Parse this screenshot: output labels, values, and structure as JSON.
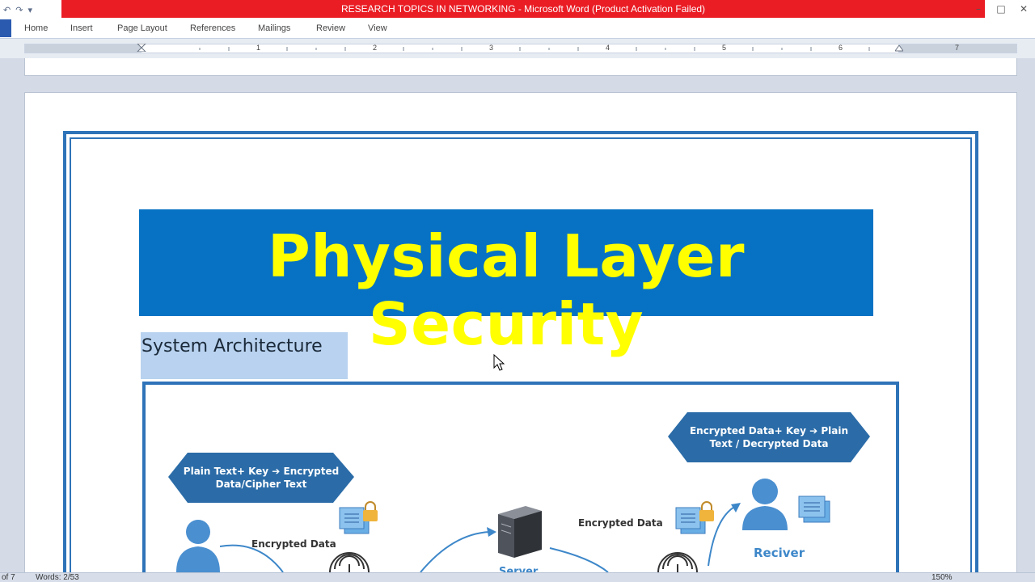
{
  "window": {
    "title": "RESEARCH TOPICS IN NETWORKING  -  Microsoft Word (Product Activation Failed)",
    "title_bar_color": "#ea1c24",
    "controls": [
      "minimize-icon",
      "maximize-icon",
      "close-icon"
    ]
  },
  "quick_access": {
    "undo_icon": "↶",
    "redo_icon": "↷",
    "customize_icon": "▾"
  },
  "ribbon": {
    "tabs": [
      {
        "label": "Home"
      },
      {
        "label": "Insert"
      },
      {
        "label": "Page Layout"
      },
      {
        "label": "References"
      },
      {
        "label": "Mailings"
      },
      {
        "label": "Review"
      },
      {
        "label": "View"
      }
    ]
  },
  "ruler": {
    "numbers": [
      "1",
      "2",
      "3",
      "4",
      "5",
      "6",
      "7"
    ]
  },
  "document": {
    "banner_title": "Physical Layer Security",
    "banner_color": "#0772c4",
    "banner_text_color": "#ffff00",
    "section_heading": "System Architecture",
    "diagram": {
      "left_hex_line1": "Plain Text+ Key ➔ Encrypted",
      "left_hex_line2": "Data/Cipher Text",
      "right_hex_line1": "Encrypted Data+ Key ➔    Plain",
      "right_hex_line2": "Text / Decrypted Data",
      "edge_label_left": "Encrypted Data",
      "edge_label_right": "Encrypted Data",
      "receiver_label": "Reciver",
      "server_label": "Server",
      "accent_color": "#2e73b8"
    }
  },
  "status": {
    "page": "of 7",
    "words": "Words: 2/53",
    "zoom": "150%"
  }
}
